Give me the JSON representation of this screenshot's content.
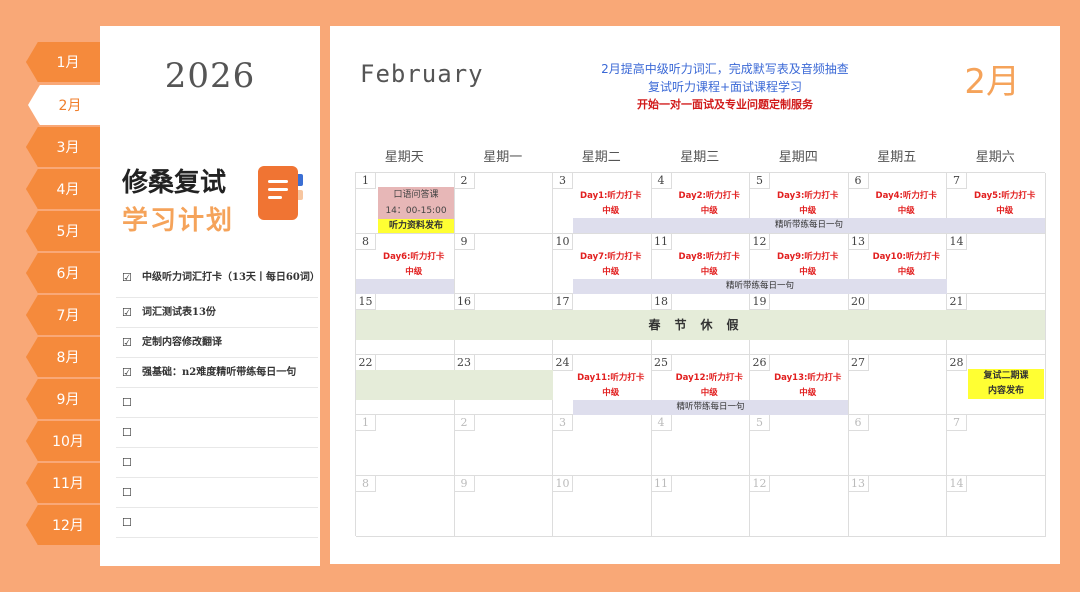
{
  "months": [
    "1月",
    "2月",
    "3月",
    "4月",
    "5月",
    "6月",
    "7月",
    "8月",
    "9月",
    "10月",
    "11月",
    "12月"
  ],
  "active_month_index": 1,
  "sidebar": {
    "year": "2026",
    "title_line1": "修桑复试",
    "title_line2": "学习计划",
    "todos": [
      {
        "checked": true,
        "text": "中级听力词汇打卡（13天丨每日60词）"
      },
      {
        "checked": true,
        "text": "词汇测试表13份"
      },
      {
        "checked": true,
        "text": "定制内容修改翻译"
      },
      {
        "checked": true,
        "text": "强基础：n2难度精听带练每日一句"
      },
      {
        "checked": false,
        "text": ""
      },
      {
        "checked": false,
        "text": ""
      },
      {
        "checked": false,
        "text": ""
      },
      {
        "checked": false,
        "text": ""
      },
      {
        "checked": false,
        "text": ""
      }
    ],
    "check_mark": "☑",
    "empty_mark": "☐"
  },
  "header": {
    "month_en": "February",
    "month_cn": "2月",
    "note_line1": "2月提高中级听力词汇，完成默写表及音频抽查",
    "note_line2": "复试听力课程+面试课程学习",
    "note_line3": "开始一对一面试及专业问题定制服务"
  },
  "calendar": {
    "weekdays": [
      "星期天",
      "星期一",
      "星期二",
      "星期三",
      "星期四",
      "星期五",
      "星期六"
    ],
    "day_numbers": [
      "1",
      "2",
      "3",
      "4",
      "5",
      "6",
      "7",
      "8",
      "9",
      "10",
      "11",
      "12",
      "13",
      "14",
      "15",
      "16",
      "17",
      "18",
      "19",
      "20",
      "21",
      "22",
      "23",
      "24",
      "25",
      "26",
      "27",
      "28",
      "1",
      "2",
      "3",
      "4",
      "5",
      "6",
      "7",
      "8",
      "9",
      "10",
      "11",
      "12",
      "13",
      "14"
    ],
    "events": {
      "oral": "口语问答课\n14：00-15:00",
      "listening_release": "听力资料发布",
      "day1": "Day1:听力打卡\n中级",
      "day2": "Day2:听力打卡\n中级",
      "day3": "Day3:听力打卡\n中级",
      "day4": "Day4:听力打卡\n中级",
      "day5": "Day5:听力打卡\n中级",
      "day6": "Day6:听力打卡\n中级",
      "day7": "Day7:听力打卡\n中级",
      "day8": "Day8:听力打卡\n中级",
      "day9": "Day9:听力打卡\n中级",
      "day10": "Day10:听力打卡\n中级",
      "day11": "Day11:听力打卡\n中级",
      "day12": "Day12:听力打卡\n中级",
      "day13": "Day13:听力打卡\n中级",
      "band": "精听带练每日一句",
      "holiday": "春节休假",
      "retest": "复试二期课\n内容发布"
    }
  }
}
